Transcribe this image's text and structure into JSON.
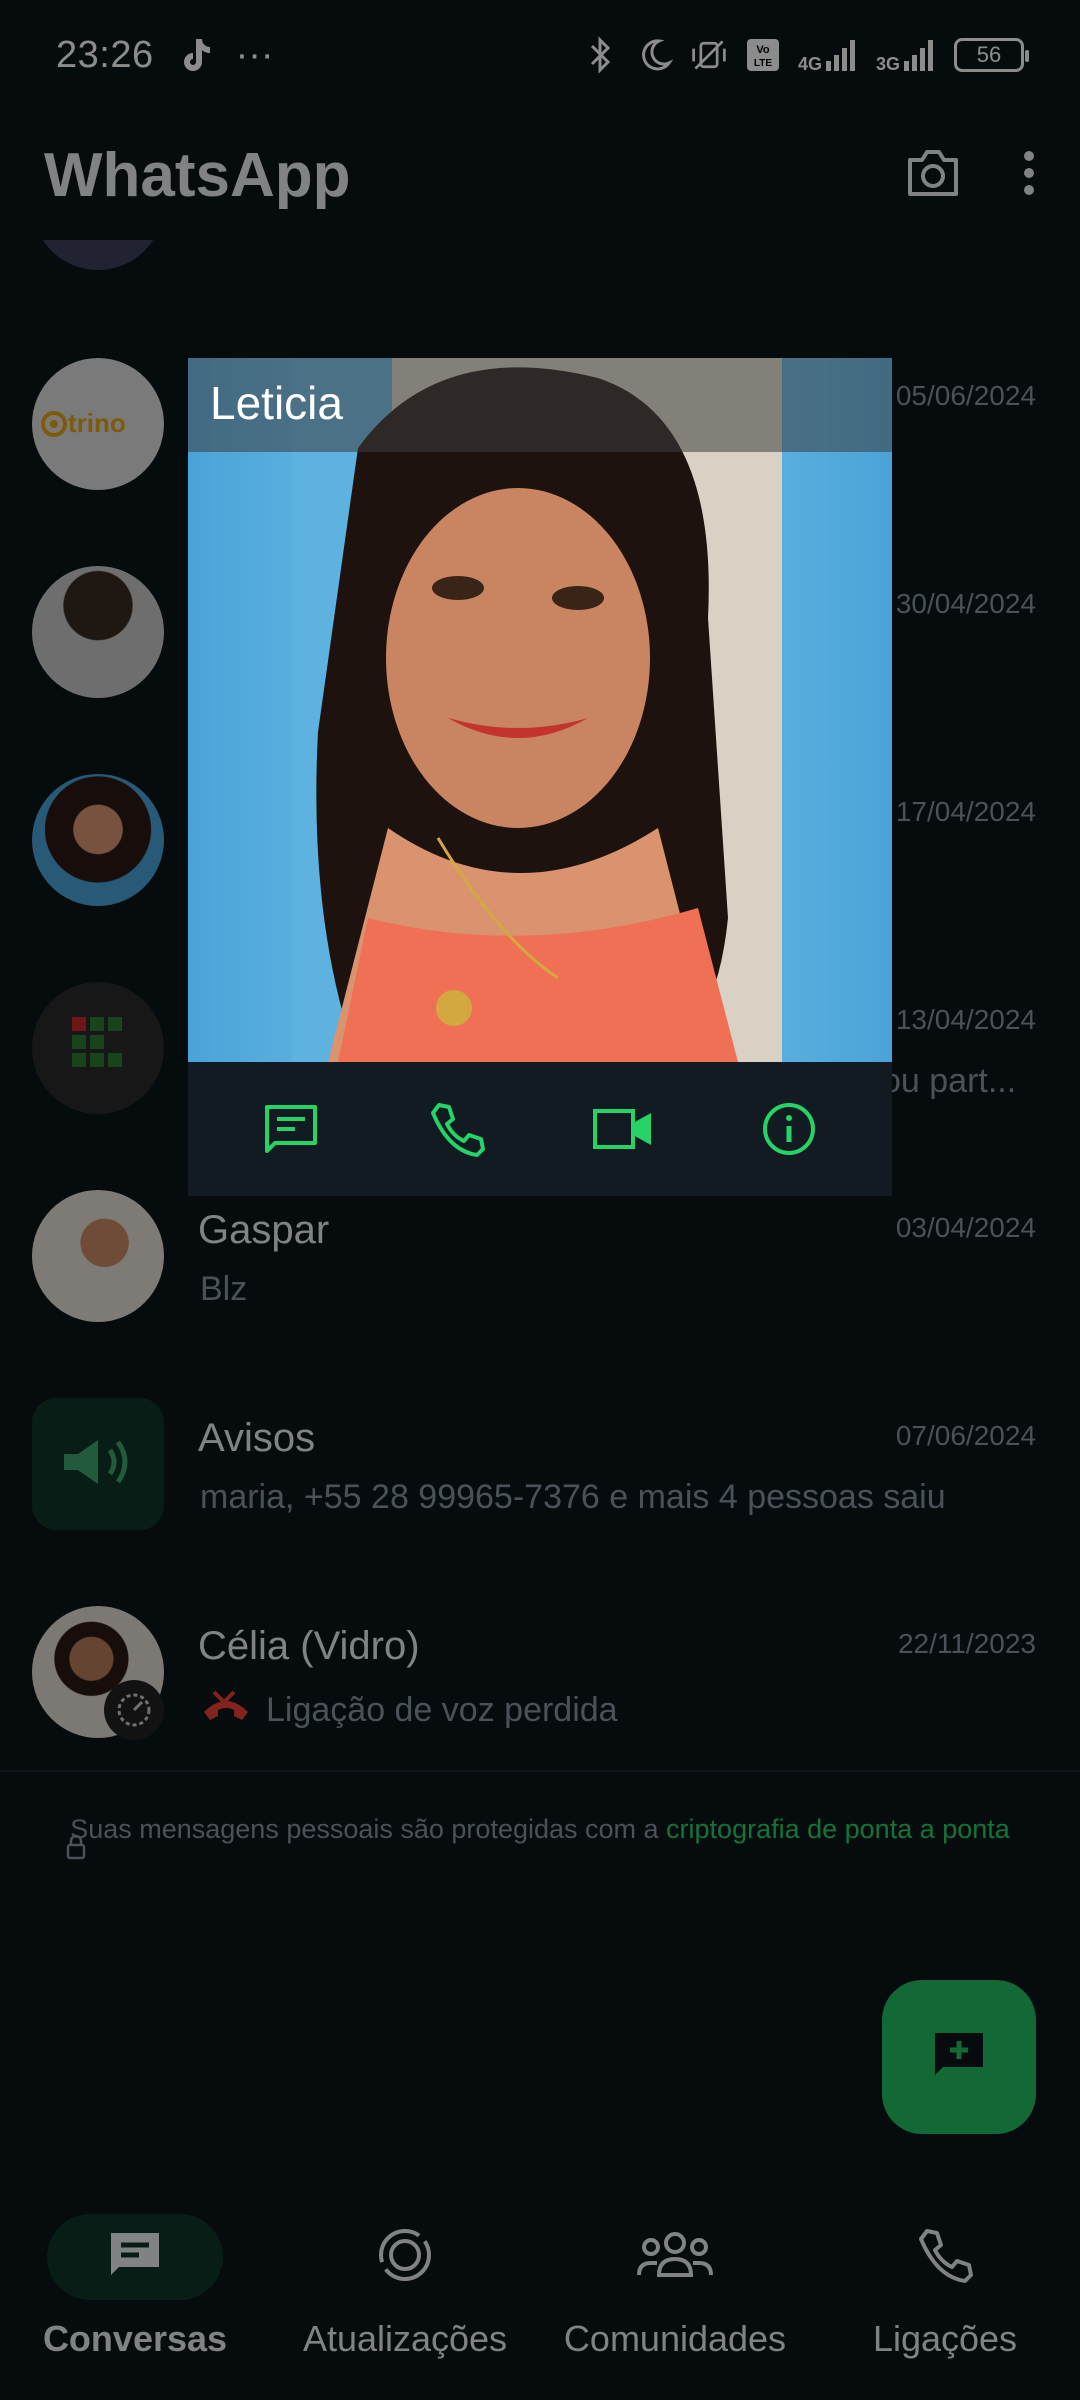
{
  "status_bar": {
    "time": "23:26",
    "more": "···",
    "network1": "4G",
    "network2": "3G",
    "battery": "56"
  },
  "app_bar": {
    "title": "WhatsApp",
    "camera_icon": "camera-icon",
    "menu_icon": "more-vert-icon"
  },
  "chats": [
    {
      "name": "",
      "date": "05/06/2024",
      "message": "",
      "avatar": "trino-logo",
      "avatar_text": "trino"
    },
    {
      "name": "",
      "date": "30/04/2024",
      "message": "",
      "avatar": "person-photo"
    },
    {
      "name": "",
      "date": "17/04/2024",
      "message": "",
      "avatar": "person-photo"
    },
    {
      "name": "",
      "date": "13/04/2024",
      "message": "ou part...",
      "avatar": "green-grid-logo"
    },
    {
      "name": "Gaspar",
      "date": "03/04/2024",
      "message": "Blz",
      "avatar": "person-photo"
    },
    {
      "name": "Avisos",
      "date": "07/06/2024",
      "message": "maria, +55 28 99965-7376 e mais 4 pessoas saiu",
      "avatar": "megaphone-icon"
    },
    {
      "name": "Célia (Vidro)",
      "date": "22/11/2023",
      "message": "Ligação de voz perdida",
      "avatar": "person-photo"
    }
  ],
  "encryption_note": {
    "text": "Suas mensagens pessoais são protegidas com a ",
    "link": "criptografia de ponta a ponta"
  },
  "popup": {
    "title": "Leticia",
    "actions": [
      "message-icon",
      "call-icon",
      "video-icon",
      "info-icon"
    ]
  },
  "bottom_nav": [
    {
      "label": "Conversas",
      "icon": "chats-icon",
      "active": true
    },
    {
      "label": "Atualizações",
      "icon": "updates-icon",
      "active": false
    },
    {
      "label": "Comunidades",
      "icon": "communities-icon",
      "active": false
    },
    {
      "label": "Ligações",
      "icon": "calls-icon",
      "active": false
    }
  ],
  "colors": {
    "background": "#0b141a",
    "accent": "#25d366",
    "fab": "#21c063",
    "missed_call": "#ea4335"
  }
}
